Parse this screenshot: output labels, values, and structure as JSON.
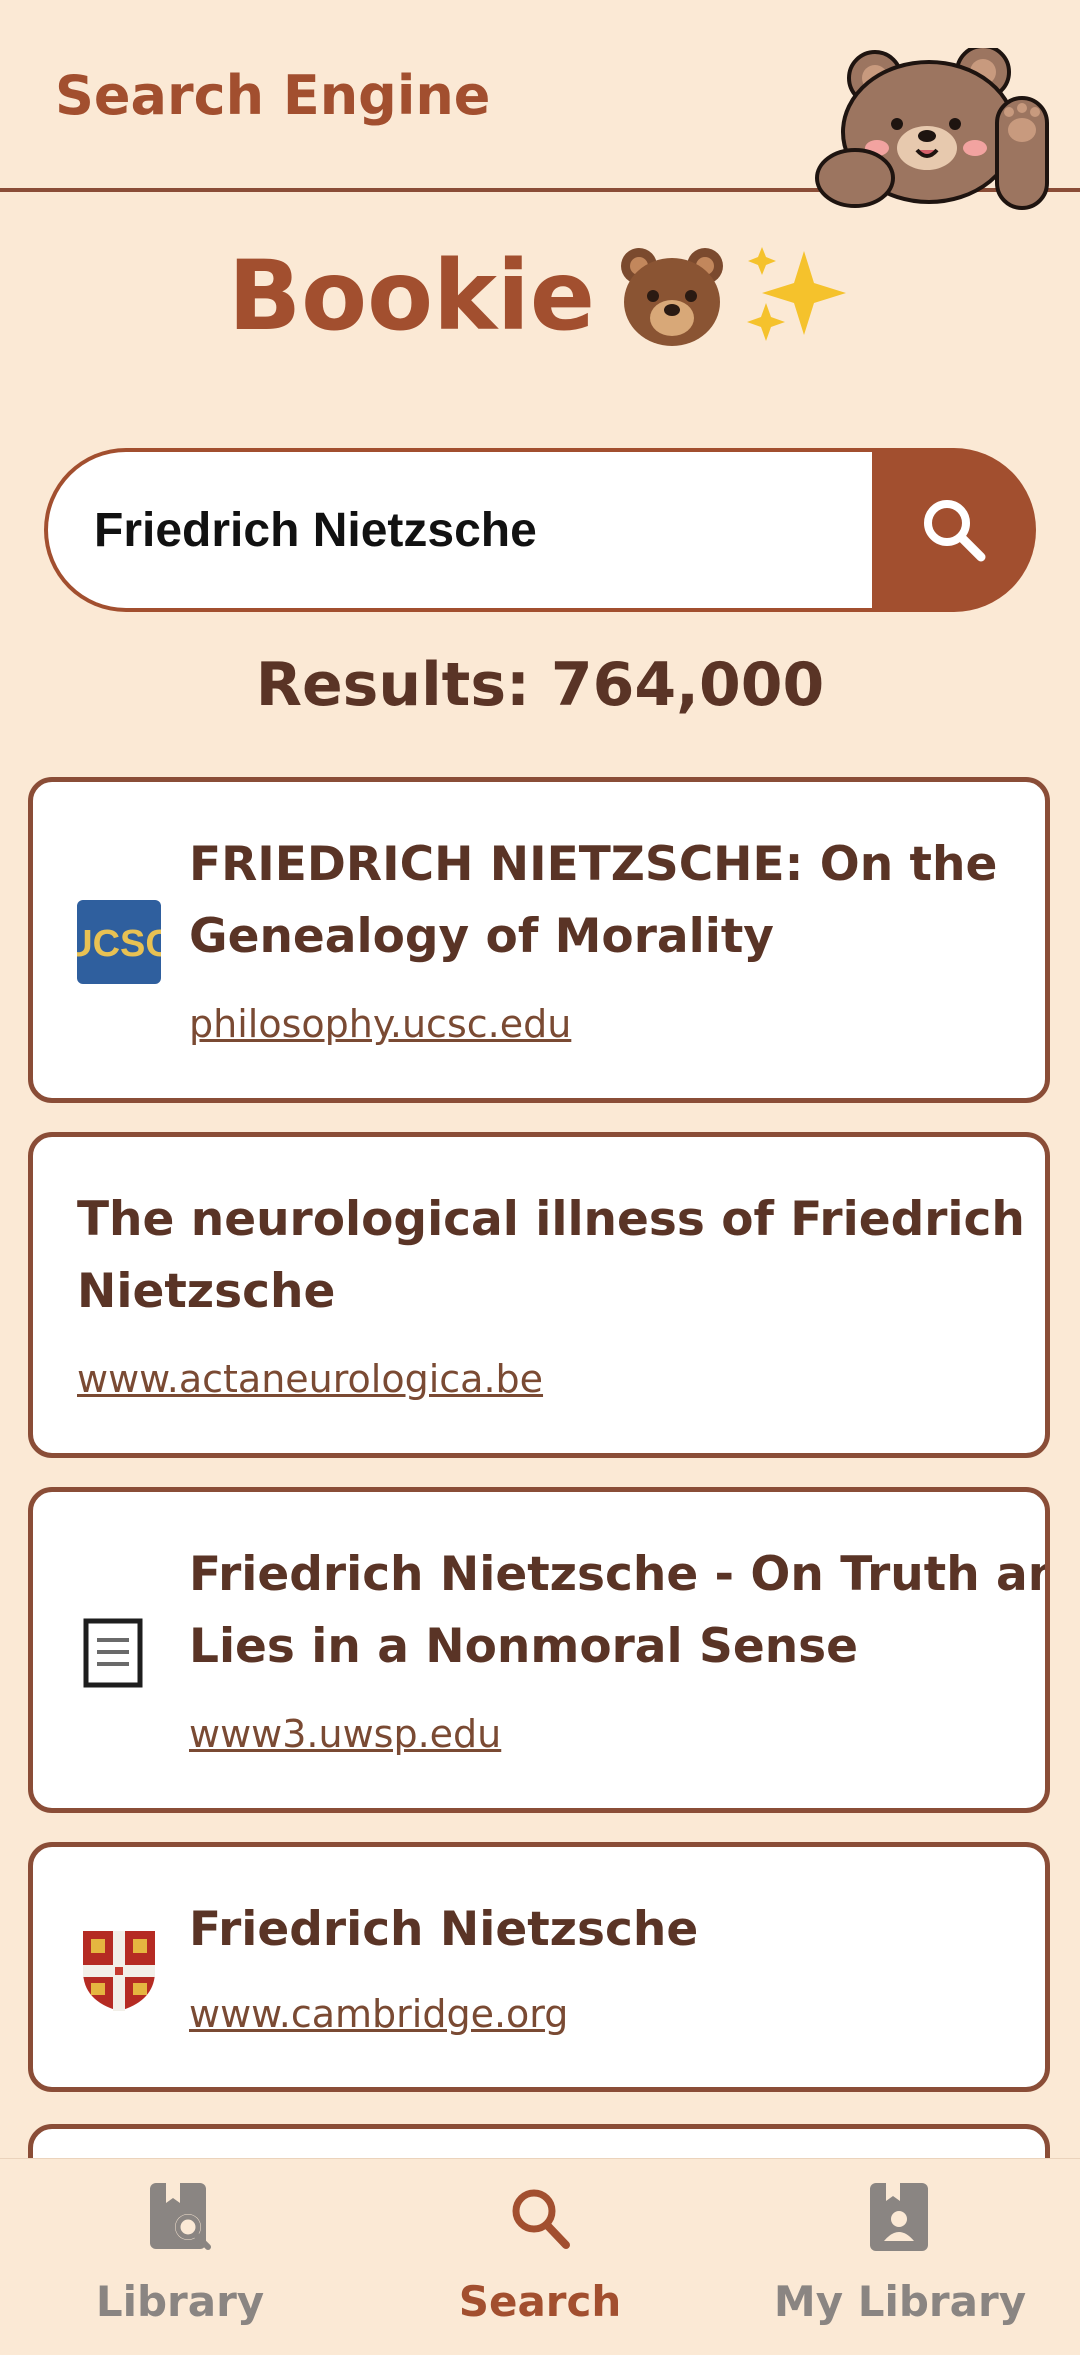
{
  "header": {
    "title": "Search Engine",
    "mascot_icon": "bear-waving-icon"
  },
  "brand": {
    "name": "Bookie",
    "emoji": "🐻 ✨",
    "icons": [
      "bear-face-icon",
      "sparkles-icon"
    ]
  },
  "search": {
    "query": "Friedrich Nietzsche",
    "button_icon": "search-icon"
  },
  "results": {
    "count_text": "Results: 764,000",
    "items": [
      {
        "title_line1": "FRIEDRICH NIETZSCHE: On the",
        "title_line2": "Genealogy of Morality",
        "url": "philosophy.ucsc.edu",
        "favicon": "ucsc-logo-icon",
        "favicon_text": "UCSC"
      },
      {
        "title_line1": "The neurological illness of Friedrich",
        "title_line2": "Nietzsche",
        "url": "www.actaneurologica.be",
        "favicon": ""
      },
      {
        "title_line1": "Friedrich Nietzsche - On Truth and",
        "title_line2": "Lies in a Nonmoral Sense",
        "url": "www3.uwsp.edu",
        "favicon": "document-icon"
      },
      {
        "title_line1": "Friedrich Nietzsche",
        "title_line2": "",
        "url": "www.cambridge.org",
        "favicon": "cambridge-crest-icon"
      }
    ]
  },
  "nav": {
    "items": [
      {
        "label": "Library",
        "icon": "library-search-icon",
        "active": false
      },
      {
        "label": "Search",
        "icon": "search-icon",
        "active": true
      },
      {
        "label": "My Library",
        "icon": "my-library-icon",
        "active": false
      }
    ]
  },
  "colors": {
    "background": "#fbe9d5",
    "accent": "#a24f2f",
    "text": "#5a3426",
    "border": "#8a4d37",
    "nav_inactive": "#8a8582"
  }
}
